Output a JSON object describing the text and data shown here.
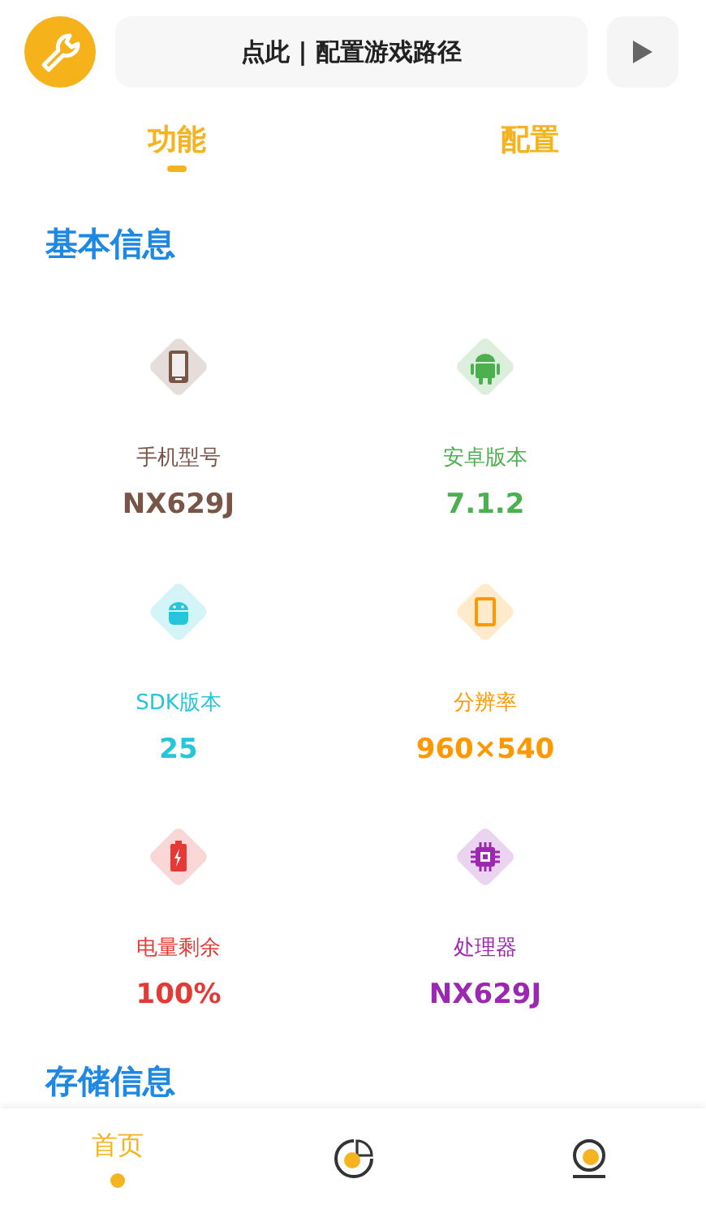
{
  "header": {
    "path_button": "点此 | 配置游戏路径"
  },
  "tabs": [
    {
      "label": "功能",
      "selected": true
    },
    {
      "label": "配置",
      "selected": false
    }
  ],
  "sections": [
    {
      "title": "基本信息",
      "items": [
        {
          "kind": "phone",
          "color": "#795548",
          "label": "手机型号",
          "value": "NX629J"
        },
        {
          "kind": "android",
          "color": "#4caf50",
          "label": "安卓版本",
          "value": "7.1.2"
        },
        {
          "kind": "android-head",
          "color": "#26c6da",
          "label": "SDK版本",
          "value": "25"
        },
        {
          "kind": "tablet",
          "color": "#ff9800",
          "label": "分辨率",
          "value": "960×540"
        },
        {
          "kind": "battery",
          "color": "#e53935",
          "label": "电量剩余",
          "value": "100%"
        },
        {
          "kind": "chip",
          "color": "#9c27b0",
          "label": "处理器",
          "value": "NX629J"
        }
      ]
    },
    {
      "title": "存储信息"
    }
  ],
  "bottom_nav": [
    {
      "kind": "text",
      "label": "首页",
      "selected": true
    },
    {
      "kind": "chart",
      "selected": false
    },
    {
      "kind": "profile",
      "selected": false
    }
  ]
}
